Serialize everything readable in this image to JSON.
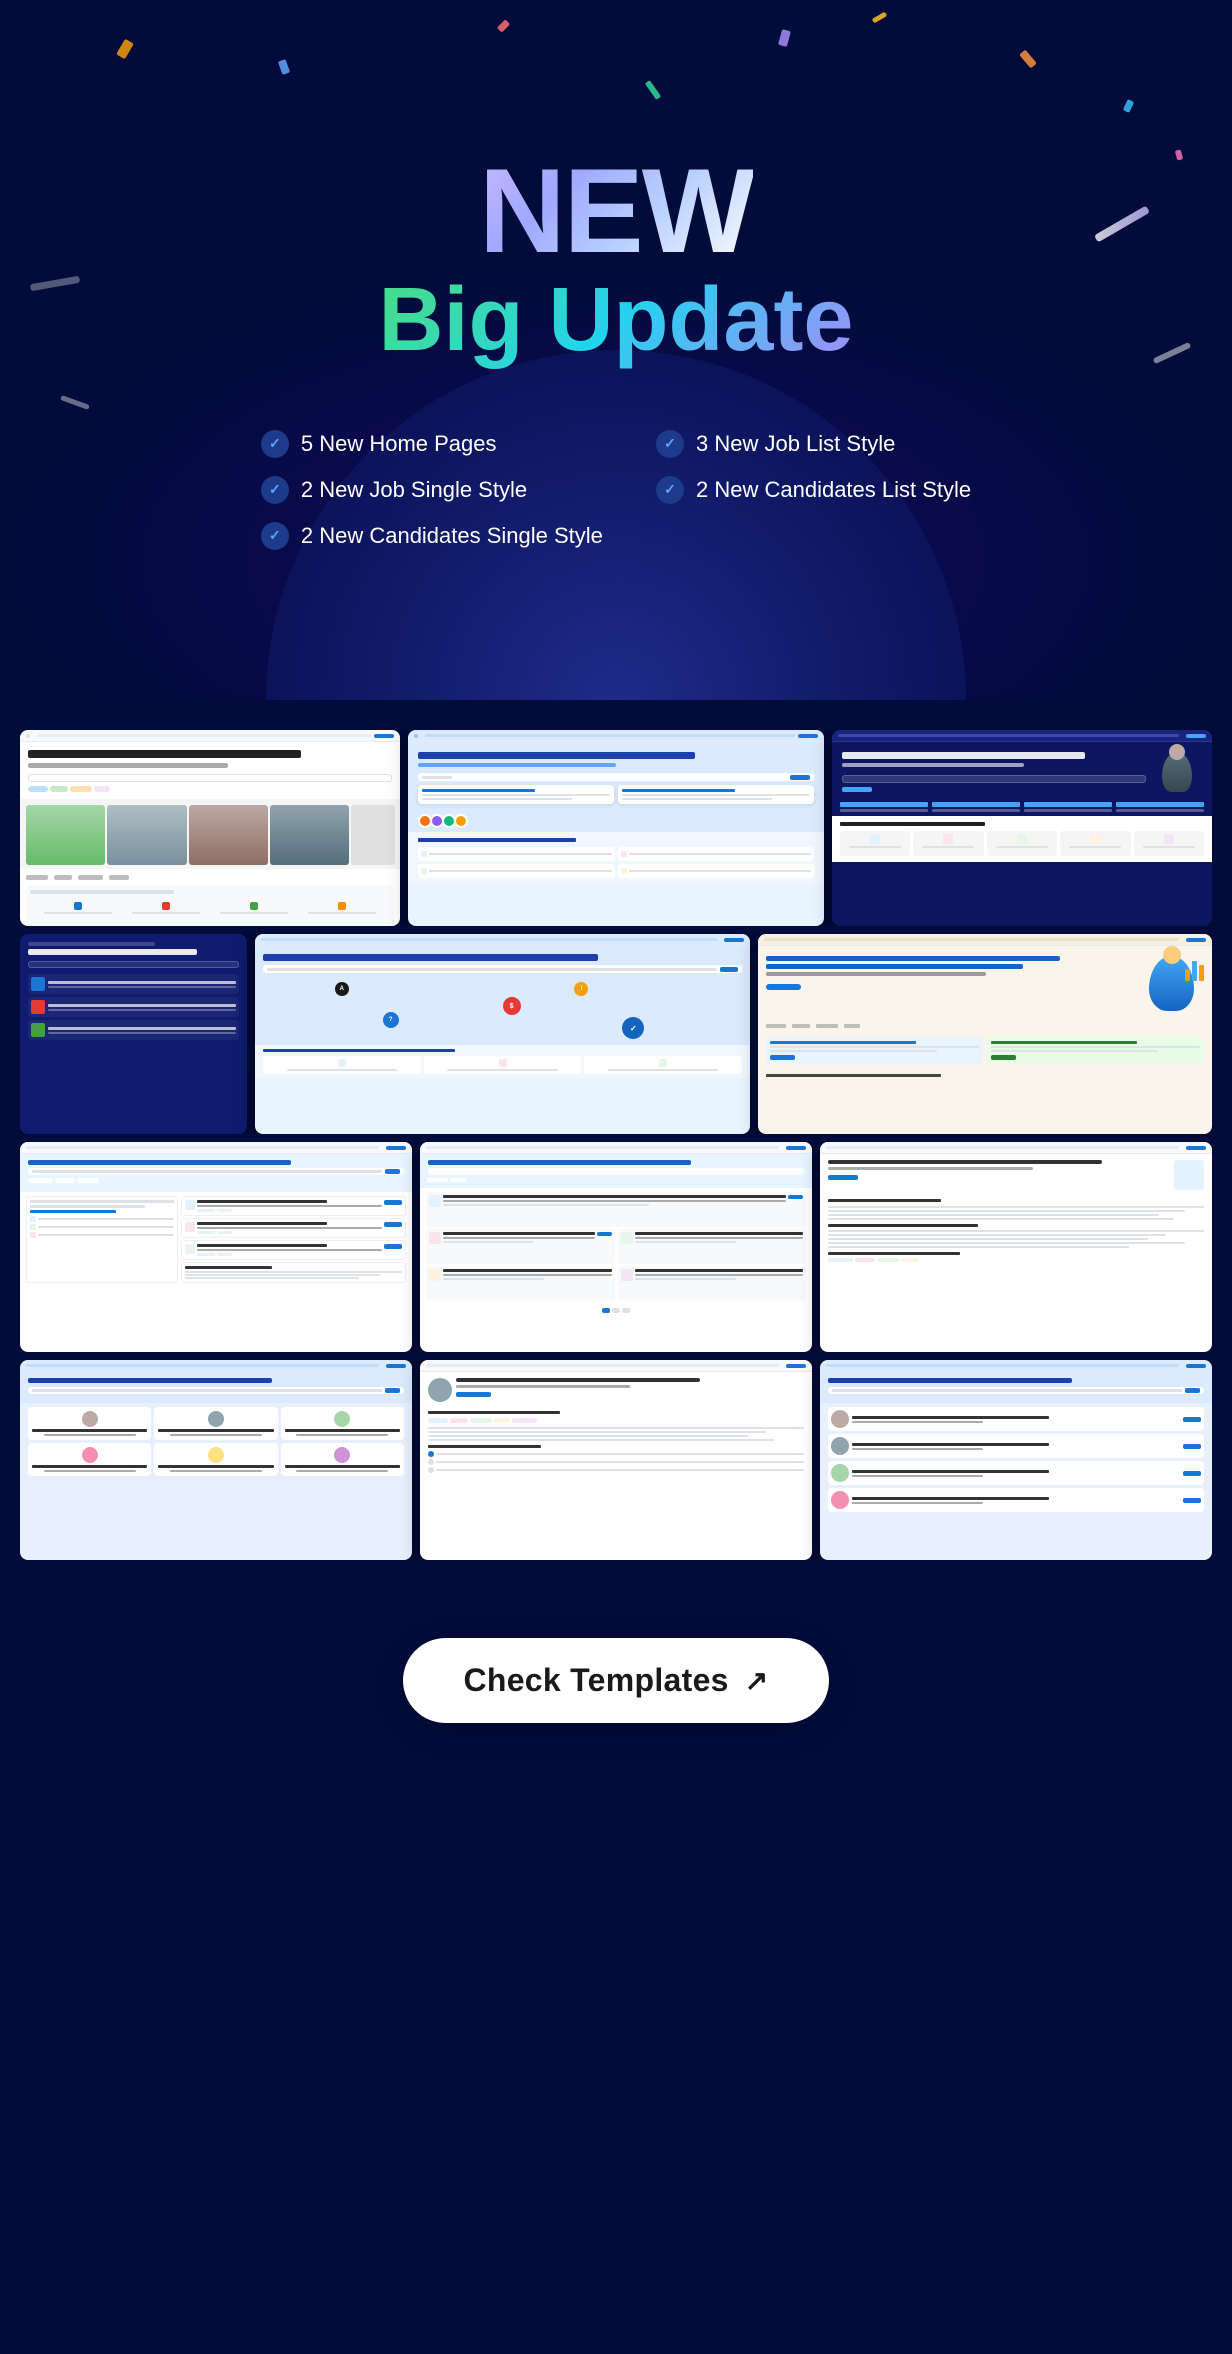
{
  "hero": {
    "title_new": "NEW",
    "title_big_update": "Big Update",
    "features": [
      {
        "id": "f1",
        "text": "5 New Home Pages",
        "col": 1
      },
      {
        "id": "f2",
        "text": "3 New Job List Style",
        "col": 2
      },
      {
        "id": "f3",
        "text": "2 New Job Single Style",
        "col": 1
      },
      {
        "id": "f4",
        "text": "2 New Candidates List Style",
        "col": 2
      },
      {
        "id": "f5",
        "text": "2 New Candidates Single Style",
        "col": "full"
      }
    ]
  },
  "screenshots": {
    "row1": [
      {
        "id": "r1c1",
        "type": "white",
        "heading": "We find the best jobs for you"
      },
      {
        "id": "r1c2",
        "type": "light-blue",
        "heading": "We find the best jobs for you"
      },
      {
        "id": "r1c3",
        "type": "dark",
        "heading": "Over 93,675+ jobs are waiting for you"
      }
    ],
    "row2": [
      {
        "id": "r2c1",
        "type": "dark-blue",
        "heading": "For you!"
      },
      {
        "id": "r2c2",
        "type": "light-blue",
        "heading": "Over 1200+ jobs are waiting for you"
      },
      {
        "id": "r2c3",
        "type": "beige",
        "heading": "There Are 93,178 Postings Here For you!"
      }
    ],
    "row3": [
      {
        "id": "r3c1",
        "type": "white",
        "heading": "There Are 93,178 Postings Here For you!"
      },
      {
        "id": "r3c2",
        "type": "white",
        "heading": "There Are 93,175 Postings Here For you!"
      },
      {
        "id": "r3c3",
        "type": "white",
        "heading": "Software Engineer (Android), Librarie"
      }
    ],
    "row4": [
      {
        "id": "r4c1",
        "type": "light-blue",
        "heading": "Hire people for your business"
      },
      {
        "id": "r4c2",
        "type": "white",
        "heading": "Software Engineer (Android), Librarie"
      },
      {
        "id": "r4c3",
        "type": "light-blue",
        "heading": "Hire people for your business"
      }
    ]
  },
  "cta": {
    "label": "Check Templates",
    "arrow": "↗"
  },
  "colors": {
    "accent_blue": "#1976d2",
    "dark_navy": "#020b3a",
    "gradient_start": "#4ade80",
    "gradient_end": "#a78bfa"
  }
}
